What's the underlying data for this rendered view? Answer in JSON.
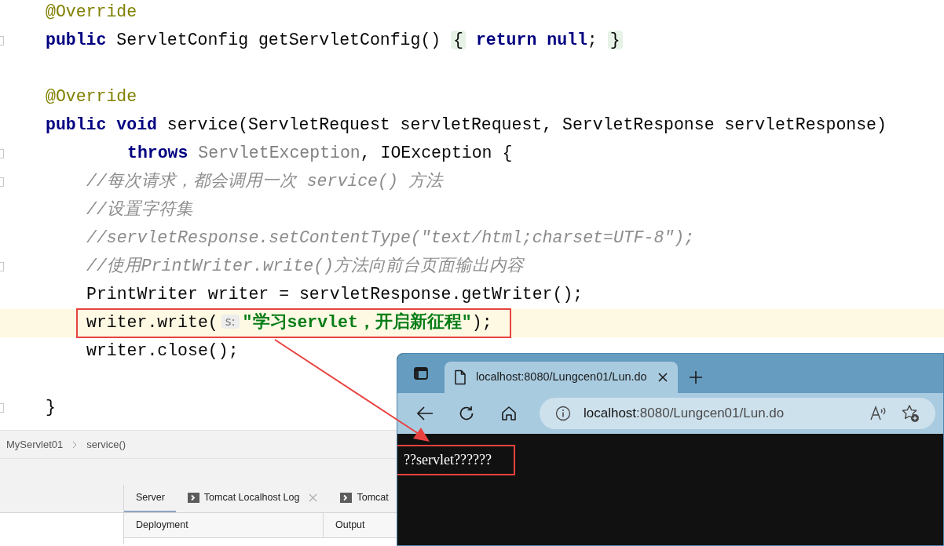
{
  "editor": {
    "lines": [
      {
        "kind": "declaration",
        "tokens": [
          {
            "kind": "annotation",
            "text": "@Override"
          }
        ]
      },
      {
        "kind": "declaration",
        "fold_marker": true,
        "tokens": [
          {
            "kind": "keyword",
            "text": "public"
          },
          {
            "kind": "plain",
            "text": " ServletConfig getServletConfig() "
          },
          {
            "kind": "folded",
            "text": "{"
          },
          {
            "kind": "keyword",
            "text": " return"
          },
          {
            "kind": "keyword",
            "text": " null"
          },
          {
            "kind": "plain",
            "text": "; "
          },
          {
            "kind": "folded",
            "text": "}"
          }
        ]
      },
      {
        "kind": "blank"
      },
      {
        "kind": "declaration",
        "tokens": [
          {
            "kind": "annotation",
            "text": "@Override"
          }
        ]
      },
      {
        "kind": "declaration",
        "tokens": [
          {
            "kind": "keyword",
            "text": "public"
          },
          {
            "kind": "keyword",
            "text": " void"
          },
          {
            "kind": "plain",
            "text": " service(ServletRequest servletRequest, ServletResponse servletResponse)"
          }
        ]
      },
      {
        "kind": "continuation",
        "fold_marker": true,
        "tokens": [
          {
            "kind": "keyword",
            "text": "throws"
          },
          {
            "kind": "muted",
            "text": " ServletException"
          },
          {
            "kind": "plain",
            "text": ", IOException {"
          }
        ]
      },
      {
        "kind": "body",
        "fold_marker": true,
        "tokens": [
          {
            "kind": "comment",
            "text": "//每次请求，都会调用一次 service() 方法"
          }
        ]
      },
      {
        "kind": "body",
        "tokens": [
          {
            "kind": "comment",
            "text": "//设置字符集"
          }
        ]
      },
      {
        "kind": "body",
        "tokens": [
          {
            "kind": "comment",
            "text": "//servletResponse.setContentType(\"text/html;charset=UTF-8\");"
          }
        ]
      },
      {
        "kind": "body",
        "fold_marker": true,
        "tokens": [
          {
            "kind": "comment",
            "text": "//使用PrintWriter.write()方法向前台页面输出内容"
          }
        ]
      },
      {
        "kind": "body",
        "tokens": [
          {
            "kind": "plain",
            "text": "PrintWriter writer = servletResponse.getWriter();"
          }
        ]
      },
      {
        "kind": "body",
        "current": true,
        "annotated": true,
        "tokens": [
          {
            "kind": "plain",
            "text": "writer.write("
          },
          {
            "kind": "hint",
            "text": "s:"
          },
          {
            "kind": "string",
            "text": "\"学习servlet，开启新征程\""
          },
          {
            "kind": "plain",
            "text": ");"
          }
        ]
      },
      {
        "kind": "body",
        "tokens": [
          {
            "kind": "plain",
            "text": "writer.close();"
          }
        ]
      },
      {
        "kind": "blank"
      },
      {
        "kind": "declaration",
        "fold_marker": true,
        "tokens": [
          {
            "kind": "plain",
            "text": "}"
          }
        ]
      }
    ]
  },
  "breadcrumb": [
    "MyServlet01",
    "service()"
  ],
  "tool_window": {
    "tabs": [
      {
        "label": "Server",
        "kind": "plain",
        "selected": true,
        "closable": false
      },
      {
        "label": "Tomcat Localhost Log",
        "kind": "console",
        "selected": false,
        "closable": true
      },
      {
        "label": "Tomcat",
        "kind": "console",
        "selected": false,
        "closable": false
      }
    ],
    "columns": [
      "Deployment",
      "Output"
    ]
  },
  "browser": {
    "tab_title": "localhost:8080/Lungcen01/Lun.do",
    "url_host": "localhost",
    "url_rest": ":8080/Lungcen01/Lun.do",
    "output": "??servlet??????",
    "output_annotated": true
  }
}
